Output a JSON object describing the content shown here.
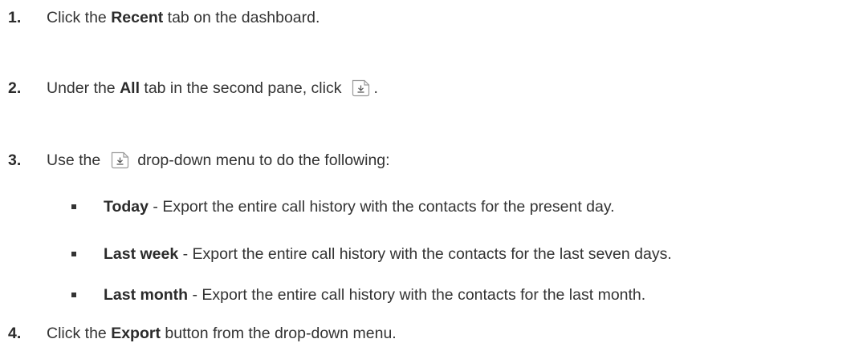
{
  "steps": [
    {
      "number": "1.",
      "pre": "Click the ",
      "bold": "Recent",
      "post": " tab on the dashboard."
    },
    {
      "number": "2.",
      "pre": "Under the ",
      "bold": "All",
      "post": " tab in the second pane, click",
      "after_icon": "."
    },
    {
      "number": "3.",
      "pre": "Use the",
      "post": "drop-down menu to do the following:"
    },
    {
      "number": "4.",
      "pre": "Click the ",
      "bold": "Export",
      "post": " button from the drop-down menu."
    }
  ],
  "options": [
    {
      "term": "Today",
      "desc": " - Export the entire call history with the contacts for the present day."
    },
    {
      "term": "Last week",
      "desc": " - Export the entire call history with the contacts for the last seven days."
    },
    {
      "term": "Last month",
      "desc": " - Export the entire call history with the contacts for the last month."
    }
  ],
  "icons": {
    "export": "export-download-icon"
  }
}
